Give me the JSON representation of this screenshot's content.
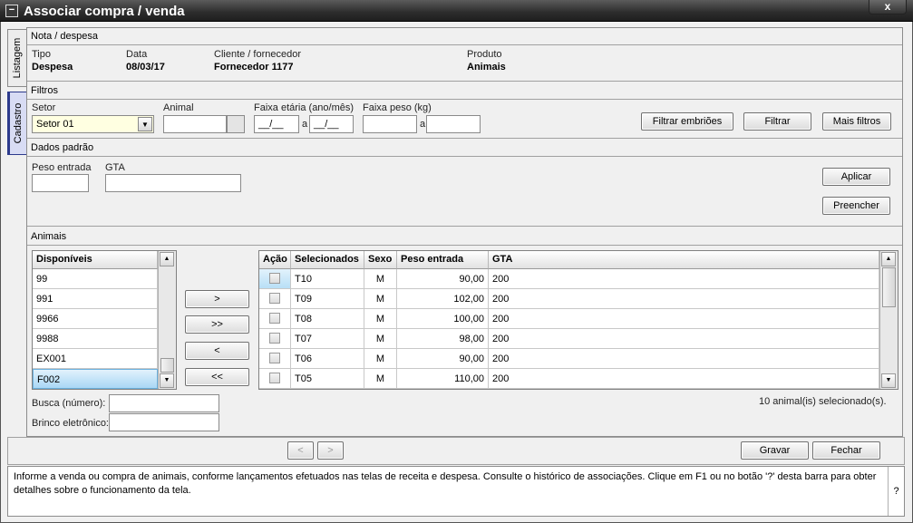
{
  "window": {
    "title": "Associar compra / venda",
    "close_label": "x",
    "sysmenu_label": "−"
  },
  "side_tabs": [
    "Listagem",
    "Cadastro"
  ],
  "nota": {
    "section_title": "Nota / despesa",
    "fields": [
      {
        "label": "Tipo",
        "value": "Despesa"
      },
      {
        "label": "Data",
        "value": "08/03/17"
      },
      {
        "label": "Cliente / fornecedor",
        "value": "Fornecedor 1177"
      },
      {
        "label": "Produto",
        "value": "Animais"
      }
    ]
  },
  "filtros": {
    "section_title": "Filtros",
    "setor_label": "Setor",
    "setor_value": "Setor 01",
    "animal_label": "Animal",
    "animal_value": "",
    "faixa_etaria_label": "Faixa etária (ano/mês)",
    "faixa_etaria_from": "__/__",
    "faixa_etaria_to": "__/__",
    "faixa_peso_label": "Faixa peso (kg)",
    "range_sep": "a",
    "buttons": {
      "filtrar_embrioes": "Filtrar embriões",
      "filtrar": "Filtrar",
      "mais_filtros": "Mais filtros"
    }
  },
  "dados_padrao": {
    "section_title": "Dados padrão",
    "peso_entrada_label": "Peso entrada",
    "gta_label": "GTA",
    "buttons": {
      "aplicar": "Aplicar",
      "preencher": "Preencher"
    }
  },
  "animais": {
    "section_title": "Animais",
    "disponiveis_header": "Disponíveis",
    "disponiveis": [
      "99",
      "991",
      "9966",
      "9988",
      "EX001",
      "F002"
    ],
    "move_buttons": [
      ">",
      ">>",
      "<",
      "<<"
    ],
    "selected_columns": [
      "Ação",
      "Selecionados",
      "Sexo",
      "Peso entrada",
      "GTA"
    ],
    "selected_rows": [
      {
        "id": "T10",
        "sexo": "M",
        "peso": "90,00",
        "gta": "200"
      },
      {
        "id": "T09",
        "sexo": "M",
        "peso": "102,00",
        "gta": "200"
      },
      {
        "id": "T08",
        "sexo": "M",
        "peso": "100,00",
        "gta": "200"
      },
      {
        "id": "T07",
        "sexo": "M",
        "peso": "98,00",
        "gta": "200"
      },
      {
        "id": "T06",
        "sexo": "M",
        "peso": "90,00",
        "gta": "200"
      },
      {
        "id": "T05",
        "sexo": "M",
        "peso": "110,00",
        "gta": "200"
      }
    ],
    "busca_label": "Busca (número):",
    "brinco_label": "Brinco eletrônico:",
    "count_text": "10 animal(is) selecionado(s)."
  },
  "footer": {
    "prev_label": "<",
    "next_label": ">",
    "gravar": "Gravar",
    "fechar": "Fechar",
    "help_text": "Informe a venda ou compra de animais, conforme lançamentos efetuados nas telas de receita e despesa. Consulte o histórico de associações. Clique em F1 ou no botão '?' desta barra para obter detalhes sobre o funcionamento da tela.",
    "help_button": "?"
  }
}
